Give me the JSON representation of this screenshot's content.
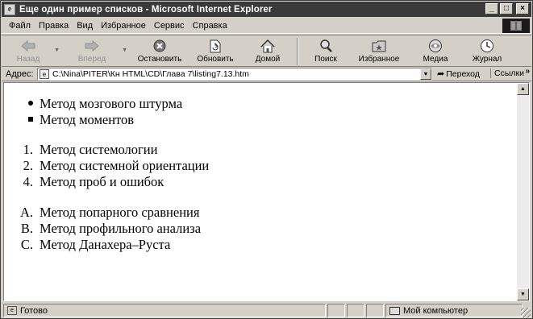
{
  "window": {
    "title": "Еще один пример списков - Microsoft Internet Explorer",
    "controls": {
      "minimize": "_",
      "maximize": "□",
      "close": "×"
    }
  },
  "menu": [
    "Файл",
    "Правка",
    "Вид",
    "Избранное",
    "Сервис",
    "Справка"
  ],
  "toolbar": {
    "back": "Назад",
    "forward": "Вперед",
    "stop": "Остановить",
    "refresh": "Обновить",
    "home": "Домой",
    "search": "Поиск",
    "favorites": "Избранное",
    "media": "Медиа",
    "history": "Журнал"
  },
  "address": {
    "label": "Адрес:",
    "url": "C:\\Nina\\PITER\\Кн HTML\\CD\\Глава 7\\listing7.13.htm",
    "go_label": "Переход",
    "links_label": "Ссылки",
    "more": "»"
  },
  "content": {
    "unordered": [
      {
        "marker": "disc",
        "text": "Метод мозгового штурма"
      },
      {
        "marker": "square",
        "text": "Метод моментов"
      }
    ],
    "ordered_numbers": [
      {
        "marker": "1.",
        "text": "Метод системологии"
      },
      {
        "marker": "2.",
        "text": "Метод системной ориентации"
      },
      {
        "marker": "4.",
        "text": "Метод проб и ошибок"
      }
    ],
    "ordered_letters": [
      {
        "marker": "A.",
        "text": "Метод попарного сравнения"
      },
      {
        "marker": "B.",
        "text": "Метод профильного анализа"
      },
      {
        "marker": "C.",
        "text": "Метод Данахера–Руста"
      }
    ]
  },
  "status": {
    "text": "Готово",
    "zone": "Мой компьютер"
  }
}
